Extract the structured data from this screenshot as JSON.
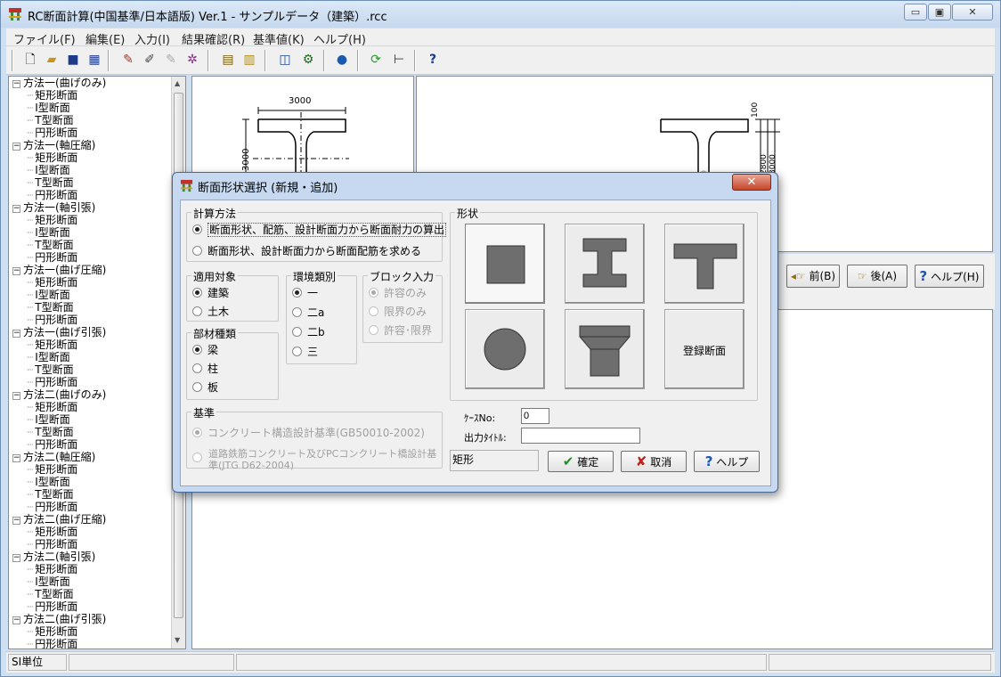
{
  "window": {
    "title": "RC断面計算(中国基準/日本語版) Ver.1 - サンプルデータ（建築）.rcc",
    "min_glyph": "▭",
    "max_glyph": "▣",
    "close_glyph": "✕"
  },
  "menu": {
    "items": [
      "ファイル(F)",
      "編集(E)",
      "入力(I)",
      "結果確認(R)",
      "基準値(K)",
      "ヘルプ(H)"
    ]
  },
  "toolbar": {
    "icons": [
      "new-file-icon",
      "open-folder-icon",
      "save-icon",
      "print-icon",
      "edit-input-icon",
      "edit-sections-icon",
      "edit-gray-icon",
      "color-settings-icon",
      "report-icon",
      "report-output-icon",
      "chart-icon",
      "calculate-icon",
      "globe-icon",
      "refresh-icon",
      "tree-view-icon",
      "help-icon"
    ]
  },
  "tree": {
    "groups": [
      {
        "label": "方法一(曲げのみ)",
        "children": [
          "矩形断面",
          "I型断面",
          "T型断面",
          "円形断面"
        ]
      },
      {
        "label": "方法一(軸圧縮)",
        "children": [
          "矩形断面",
          "I型断面",
          "T型断面",
          "円形断面"
        ]
      },
      {
        "label": "方法一(軸引張)",
        "children": [
          "矩形断面",
          "I型断面",
          "T型断面",
          "円形断面"
        ]
      },
      {
        "label": "方法一(曲げ圧縮)",
        "children": [
          "矩形断面",
          "I型断面",
          "T型断面",
          "円形断面"
        ]
      },
      {
        "label": "方法一(曲げ引張)",
        "children": [
          "矩形断面",
          "I型断面",
          "T型断面",
          "円形断面"
        ]
      },
      {
        "label": "方法二(曲げのみ)",
        "children": [
          "矩形断面",
          "I型断面",
          "T型断面",
          "円形断面"
        ]
      },
      {
        "label": "方法二(軸圧縮)",
        "children": [
          "矩形断面",
          "I型断面",
          "T型断面",
          "円形断面"
        ]
      },
      {
        "label": "方法二(曲げ圧縮)",
        "children": [
          "矩形断面",
          "円形断面"
        ]
      },
      {
        "label": "方法二(軸引張)",
        "children": [
          "矩形断面",
          "I型断面",
          "T型断面",
          "円形断面"
        ]
      },
      {
        "label": "方法二(曲げ引張)",
        "children": [
          "矩形断面",
          "円形断面"
        ]
      }
    ]
  },
  "preview": {
    "dim_top": "3000",
    "dim_side": "3000",
    "dim_right_top": "100",
    "dim_right_a": "2800",
    "dim_right_b": "3000"
  },
  "nav": {
    "prev_label": "前(B)",
    "next_label": "後(A)",
    "help_label": "ヘルプ(H)"
  },
  "status": {
    "unit": "SI単位"
  },
  "dialog": {
    "title": "断面形状選択 (新規・追加)",
    "close_glyph": "✕",
    "calc_method": {
      "label": "計算方法",
      "options": [
        "断面形状、配筋、設計断面力から断面耐力の算出",
        "断面形状、設計断面力から断面配筋を求める"
      ],
      "selected": 0
    },
    "target": {
      "label": "適用対象",
      "options": [
        "建築",
        "土木"
      ],
      "selected": 0
    },
    "member": {
      "label": "部材種類",
      "options": [
        "梁",
        "柱",
        "板"
      ],
      "selected": 0
    },
    "environment": {
      "label": "環境類別",
      "options": [
        "一",
        "二a",
        "二b",
        "三"
      ],
      "selected": 0
    },
    "block": {
      "label": "ブロック入力",
      "options": [
        "許容のみ",
        "限界のみ",
        "許容･限界"
      ],
      "selected": 0
    },
    "standard": {
      "label": "基準",
      "options": [
        "コンクリート構造設計基準(GB50010-2002)",
        "道路鉄筋コンクリート及びPCコンクリート橋設計基準(JTG D62-2004)"
      ],
      "selected": 0
    },
    "shape": {
      "label": "形状",
      "registered_label": "登録断面",
      "selected_name": "矩形",
      "fill_color": "#6e6e6e"
    },
    "case_no": {
      "label": "ｹｰｽNo:",
      "value": "0"
    },
    "output_title": {
      "label": "出力ﾀｲﾄﾙ:",
      "value": ""
    },
    "ok_label": "確定",
    "cancel_label": "取消",
    "help_label": "ヘルプ"
  }
}
